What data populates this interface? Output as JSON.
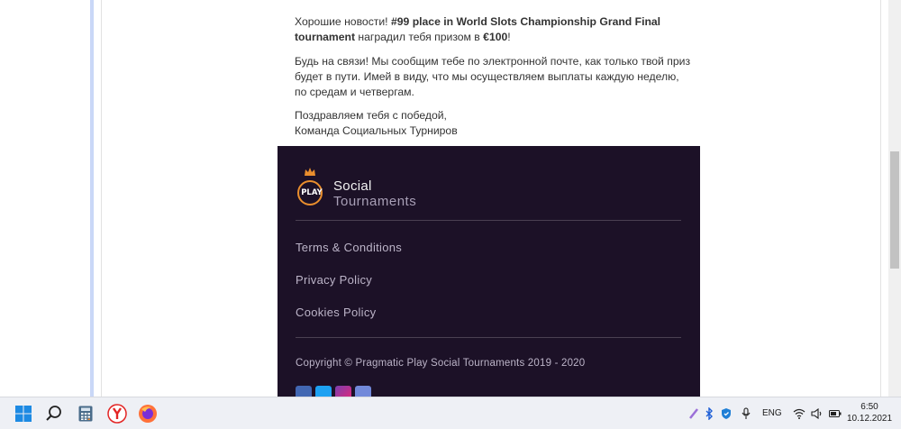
{
  "email": {
    "p1_pre": "Хорошие новости! ",
    "p1_bold": "#99 place in World Slots Championship Grand Final tournament",
    "p1_mid": " наградил тебя призом в ",
    "p1_prize": "€100",
    "p1_end": "!",
    "p2": "Будь на связи! Мы сообщим тебе по электронной почте, как только твой приз будет в пути. Имей в виду, что мы осуществляем выплаты каждую неделю, по средам и четвергам.",
    "p3_line1": "Поздравляем тебя с победой,",
    "p3_line2": "Команда Социальных Турниров"
  },
  "footer": {
    "logo_badge": "PLAY",
    "logo_line1": "Social",
    "logo_line2": "Tournaments",
    "links": [
      "Terms & Conditions",
      "Privacy Policy",
      "Cookies Policy"
    ],
    "copyright": "Copyright © Pragmatic Play Social Tournaments 2019 - 2020",
    "socials": [
      "facebook-icon",
      "twitter-icon",
      "instagram-icon",
      "discord-icon"
    ]
  },
  "taskbar": {
    "apps": [
      "windows-start-icon",
      "search-icon",
      "calculator-icon",
      "yandex-browser-icon",
      "firefox-icon"
    ],
    "language": "ENG",
    "time": "6:50",
    "date": "10.12.2021"
  },
  "colors": {
    "footer_bg": "#1c1127",
    "accent_orange": "#e98e2d",
    "link_color": "#bcb4c8"
  }
}
